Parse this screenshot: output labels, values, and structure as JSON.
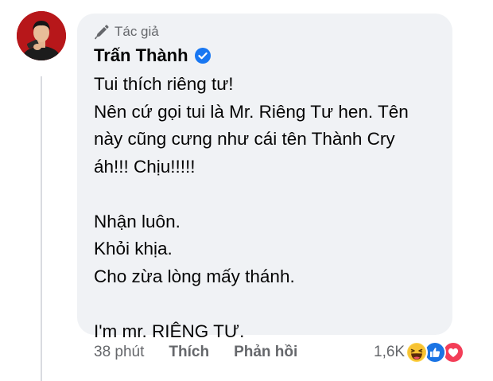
{
  "comment": {
    "author_badge": "Tác giả",
    "author_name": "Trấn Thành",
    "verified": true,
    "text_lines": [
      "Tui thích riêng tư!",
      "Nên cứ gọi tui là Mr. Riêng Tư hen. Tên",
      "này cũng cưng như cái tên Thành Cry",
      "áh!!! Chịu!!!!!",
      "",
      "Nhận luôn.",
      "Khỏi khịa.",
      "Cho zừa lòng mấy thánh.",
      "",
      "I'm mr. RIÊNG TƯ."
    ],
    "timestamp": "38 phút",
    "like_label": "Thích",
    "reply_label": "Phản hồi",
    "reaction_count": "1,6K",
    "reactions": [
      "haha-icon",
      "like-icon",
      "love-icon"
    ]
  },
  "colors": {
    "bubble": "#f0f2f5",
    "meta_text": "#65676b",
    "verified_blue": "#1877f2",
    "avatar_bg": "#b7171a"
  }
}
